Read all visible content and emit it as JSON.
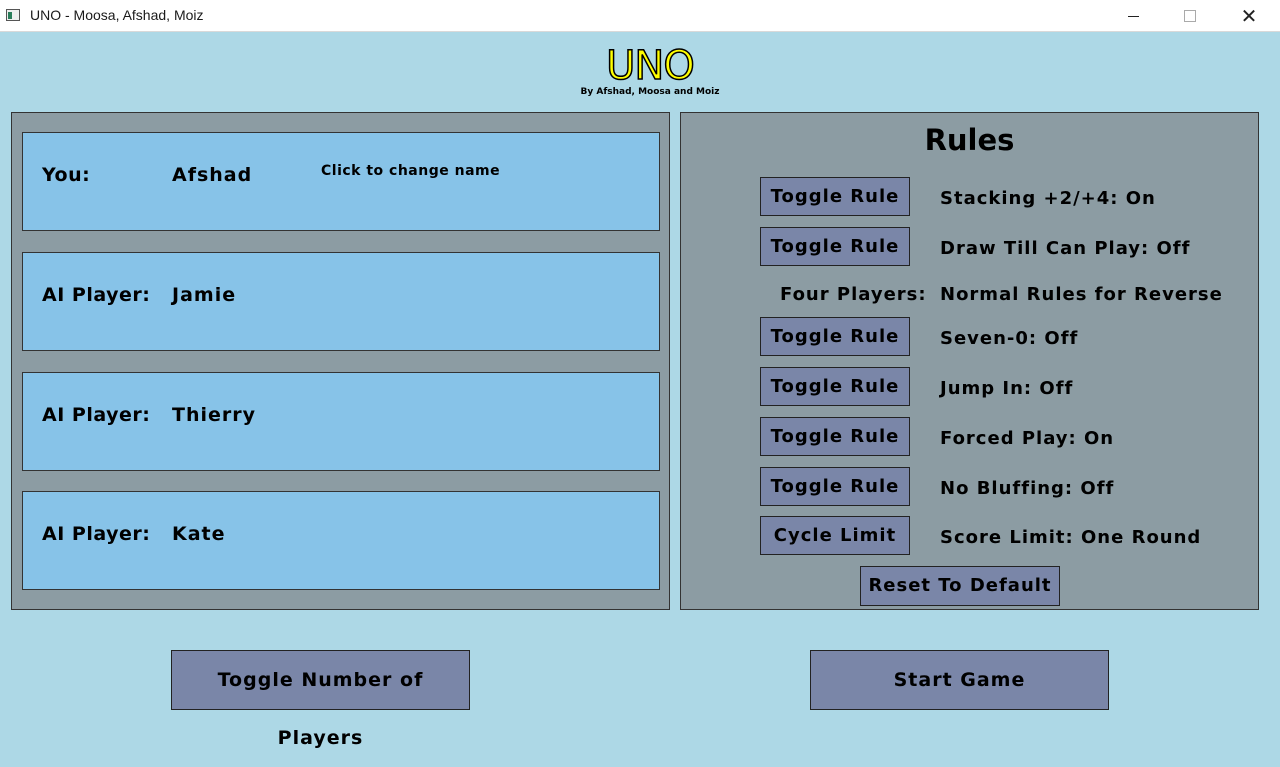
{
  "window": {
    "title": "UNO - Moosa, Afshad, Moiz",
    "close_glyph": "✕"
  },
  "header": {
    "logo": "UNO",
    "byline": "By Afshad, Moosa and Moiz"
  },
  "players": {
    "you": {
      "label": "You:",
      "name": "Afshad",
      "hint": "Click to change name"
    },
    "ai": [
      {
        "label": "AI Player:",
        "name": "Jamie"
      },
      {
        "label": "AI Player:",
        "name": "Thierry"
      },
      {
        "label": "AI Player:",
        "name": "Kate"
      }
    ]
  },
  "rules": {
    "title": "Rules",
    "toggle_label": "Toggle Rule",
    "items": [
      {
        "text": "Stacking +2/+4: On"
      },
      {
        "text": "Draw Till Can Play: Off"
      },
      {
        "text": "Seven-0: Off"
      },
      {
        "text": "Jump In: Off"
      },
      {
        "text": "Forced Play: On"
      },
      {
        "text": "No Bluffing: Off"
      }
    ],
    "four_players": {
      "label": "Four Players:",
      "value": "Normal Rules for Reverse"
    },
    "cycle_limit_label": "Cycle Limit",
    "score_limit": "Score Limit: One Round",
    "reset_label": "Reset To Default"
  },
  "actions": {
    "toggle_players_label": "Toggle Number of Players",
    "start_label": "Start Game"
  },
  "colors": {
    "background": "#add8e6",
    "panel": "#8c9ca3",
    "card": "#87c3e8",
    "button": "#7a86a8",
    "logo": "#ffff00"
  }
}
